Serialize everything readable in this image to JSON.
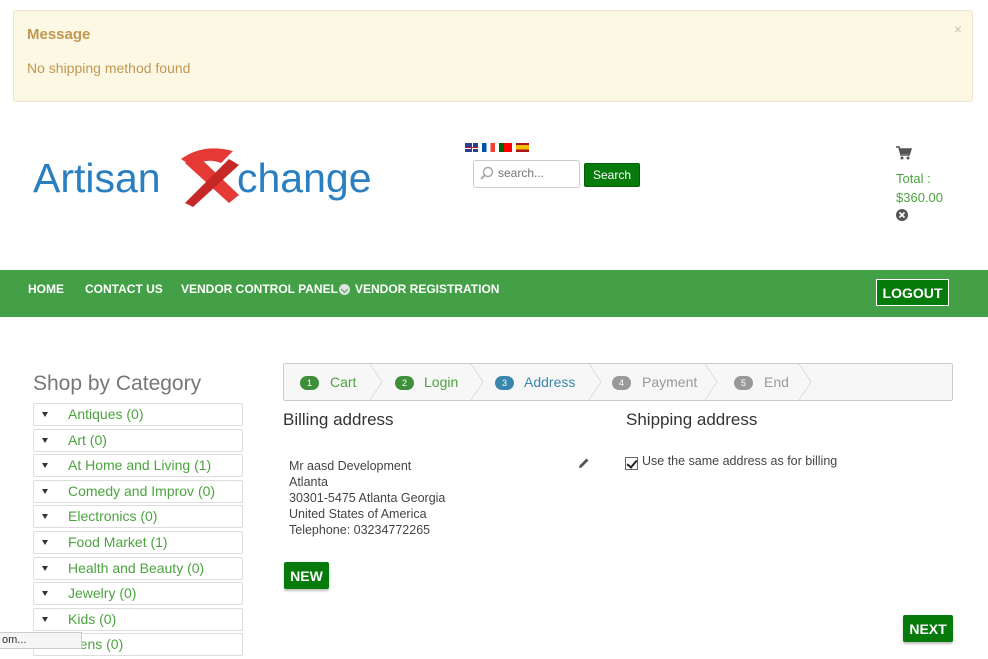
{
  "message": {
    "title": "Message",
    "text": "No shipping method found",
    "close": "×"
  },
  "header": {
    "search": {
      "placeholder": "search...",
      "button": "Search"
    },
    "cart": {
      "total_label": "Total :",
      "total_value": "$360.00"
    }
  },
  "nav": {
    "items": [
      "HOME",
      "CONTACT US",
      "VENDOR CONTROL PANEL",
      "VENDOR REGISTRATION"
    ],
    "logout": "LOGOUT"
  },
  "sidebar": {
    "title": "Shop by Category",
    "categories": [
      "Antiques (0)",
      "Art (0)",
      "At Home and Living (1)",
      "Comedy and Improv (0)",
      "Electronics (0)",
      "Food Market (1)",
      "Health and Beauty (0)",
      "Jewelry (0)",
      "Kids (0)",
      "Mens (0)"
    ]
  },
  "steps": [
    {
      "num": "1",
      "label": "Cart",
      "state": "done"
    },
    {
      "num": "2",
      "label": "Login",
      "state": "done"
    },
    {
      "num": "3",
      "label": "Address",
      "state": "active"
    },
    {
      "num": "4",
      "label": "Payment",
      "state": "todo"
    },
    {
      "num": "5",
      "label": "End",
      "state": "todo"
    }
  ],
  "billing": {
    "title": "Billing address",
    "lines": [
      "Mr aasd Development",
      "Atlanta",
      "30301-5475 Atlanta Georgia",
      "United States of America",
      "Telephone: 03234772265"
    ],
    "new_button": "NEW"
  },
  "shipping": {
    "title": "Shipping address",
    "same_label": "Use the same address as for billing"
  },
  "next_button": "NEXT",
  "status_bar": "om...",
  "colors": {
    "green": "#43a047",
    "dark_green": "#067a0b",
    "link_green": "#4ba33e",
    "warn_bg": "#fcf8e3",
    "warn_text": "#c09853"
  }
}
